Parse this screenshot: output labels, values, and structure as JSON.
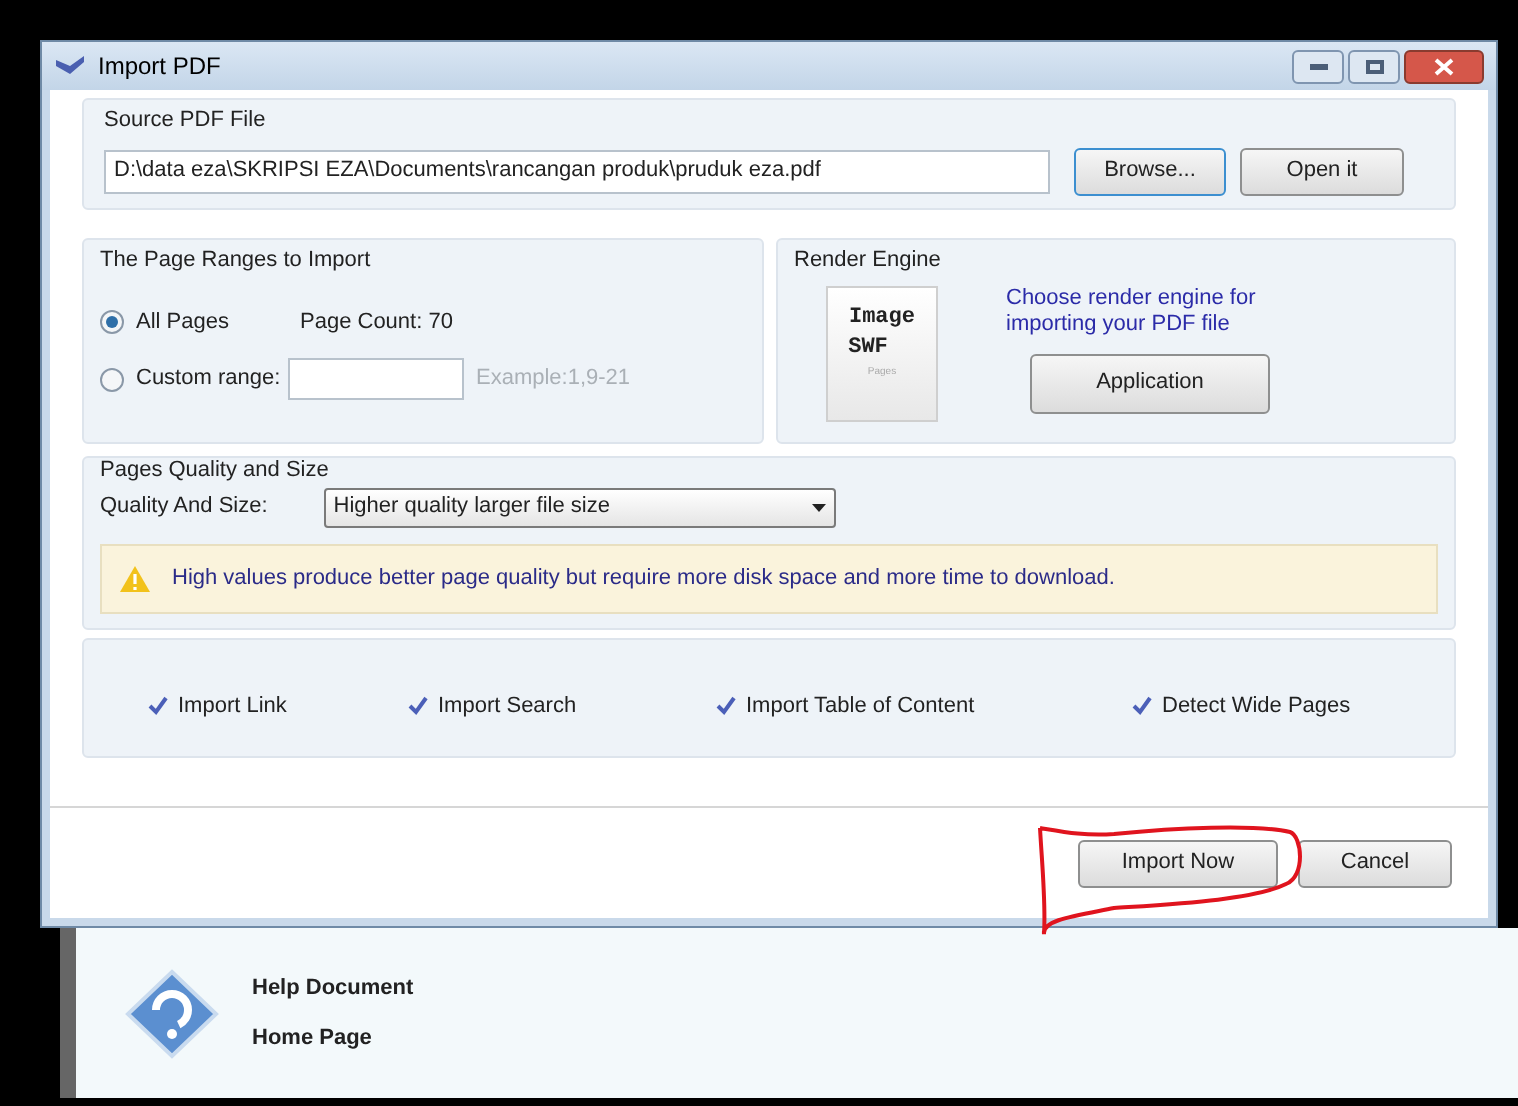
{
  "window": {
    "title": "Import PDF"
  },
  "source": {
    "title": "Source PDF File",
    "path": "D:\\data eza\\SKRIPSI EZA\\Documents\\rancangan produk\\pruduk eza.pdf",
    "browse": "Browse...",
    "open": "Open it"
  },
  "page_ranges": {
    "title": "The Page Ranges to Import",
    "options": [
      {
        "label": "All Pages",
        "selected": true
      },
      {
        "label": "Custom range:",
        "selected": false
      }
    ],
    "page_count": "Page Count: 70",
    "example": "Example:1,9-21"
  },
  "render_engine": {
    "title": "Render Engine",
    "icon_texts": [
      "Image",
      "SWF",
      "Pages"
    ],
    "hint": "Choose render engine for importing your PDF file",
    "button": "Application"
  },
  "quality": {
    "title": "Pages Quality and Size",
    "label": "Quality And Size:",
    "value": "Higher quality larger file size",
    "warning": "High values produce better page quality but require more disk space and more time to download."
  },
  "options": [
    {
      "label": "Import Link",
      "checked": true
    },
    {
      "label": "Import Search",
      "checked": true
    },
    {
      "label": "Import Table of Content",
      "checked": true
    },
    {
      "label": "Detect Wide Pages",
      "checked": true
    }
  ],
  "buttons": [
    "Import Now",
    "Cancel"
  ],
  "help": {
    "items": [
      "Help Document",
      "Home Page"
    ]
  }
}
